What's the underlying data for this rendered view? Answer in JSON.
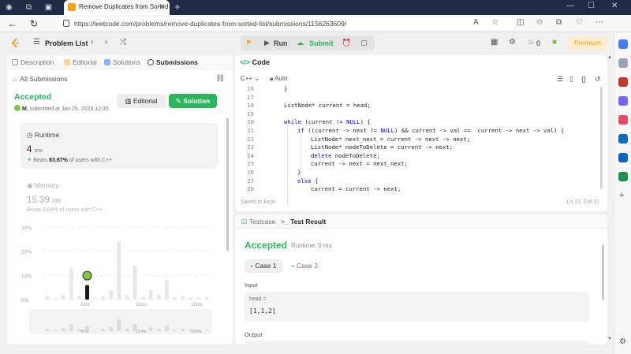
{
  "browser": {
    "tab_title": "Remove Duplicates from Sorted",
    "url": "https://leetcode.com/problems/remove-duplicates-from-sorted-list/submissions/1156263609/"
  },
  "header": {
    "problem_list": "Problem List",
    "run": "Run",
    "submit": "Submit",
    "streak": "0",
    "premium": "Premium"
  },
  "left_tabs": [
    "Description",
    "Editorial",
    "Solutions",
    "Submissions"
  ],
  "submission": {
    "back": "All Submissions",
    "status": "Accepted",
    "user": "M.",
    "submitted_text": "submitted at Jan 25, 2024 12:35",
    "editorial_btn": "Editorial",
    "solution_btn": "Solution",
    "runtime_label": "Runtime",
    "runtime_value": "4",
    "runtime_unit": "ms",
    "runtime_beats_prefix": "Beats",
    "runtime_beats": "83.87%",
    "runtime_beats_suffix": "of users with C++",
    "memory_label": "Memory",
    "memory_value": "15.39",
    "memory_unit": "MB",
    "memory_beats": "Beats 6.84% of users with C++"
  },
  "chart_data": {
    "type": "bar",
    "y_ticks": [
      "30%",
      "20%",
      "10%",
      "0%"
    ],
    "ylim": [
      0,
      30
    ],
    "x_ticks": [
      "6ms",
      "11ms",
      "16ms"
    ],
    "values": [
      1.5,
      0.5,
      2,
      13,
      1.5,
      6,
      0.5,
      1.5,
      4,
      24,
      2,
      14,
      1,
      4,
      2,
      8,
      1,
      1.5,
      1,
      1,
      1
    ],
    "highlight_index": 5,
    "mini_values": [
      1,
      0.5,
      1.2,
      2.8,
      1,
      2.2,
      0.5,
      1,
      1.8,
      5,
      1,
      3,
      0.6,
      1.6,
      1,
      2.4,
      0.6,
      1,
      0.6,
      0.6,
      0.6
    ],
    "colors": {
      "bar": "#e8e8e8",
      "highlight": "#1a1a1a"
    }
  },
  "editor": {
    "title": "Code",
    "language": "C++",
    "mode": "Auto",
    "saved": "Saved to local",
    "position": "Ln 13, Col 31",
    "lines": [
      {
        "n": "16",
        "indent": 0,
        "t": "}"
      },
      {
        "n": "17",
        "indent": 0,
        "t": ""
      },
      {
        "n": "18",
        "indent": 0,
        "t": "ListNode* current = head;"
      },
      {
        "n": "19",
        "indent": 0,
        "t": ""
      },
      {
        "n": "20",
        "indent": 0,
        "t": "while (current != NULL) {"
      },
      {
        "n": "21",
        "indent": 1,
        "t": "if ((current -> next != NULL) && current -> val ==  current -> next -> val) {"
      },
      {
        "n": "22",
        "indent": 2,
        "t": "ListNode* next_next = current -> next -> next;"
      },
      {
        "n": "23",
        "indent": 2,
        "t": "ListNode* nodeToDelete = current -> next;"
      },
      {
        "n": "24",
        "indent": 2,
        "t": "delete nodeToDelete;"
      },
      {
        "n": "25",
        "indent": 2,
        "t": "current -> next = next_next;"
      },
      {
        "n": "26",
        "indent": 1,
        "t": "}"
      },
      {
        "n": "27",
        "indent": 1,
        "t": "else {"
      },
      {
        "n": "28",
        "indent": 2,
        "t": "current = current -> next;"
      }
    ]
  },
  "result": {
    "testcase_tab": "Testcase",
    "result_tab": "Test Result",
    "status": "Accepted",
    "runtime": "Runtime: 0 ms",
    "case1": "Case 1",
    "case2": "Case 2",
    "input_label": "Input",
    "var_name": "head =",
    "var_value": "[1,1,2]",
    "output_label": "Output"
  },
  "colors": {
    "accent_green": "#2db55d",
    "brand_orange": "#ffa116"
  }
}
